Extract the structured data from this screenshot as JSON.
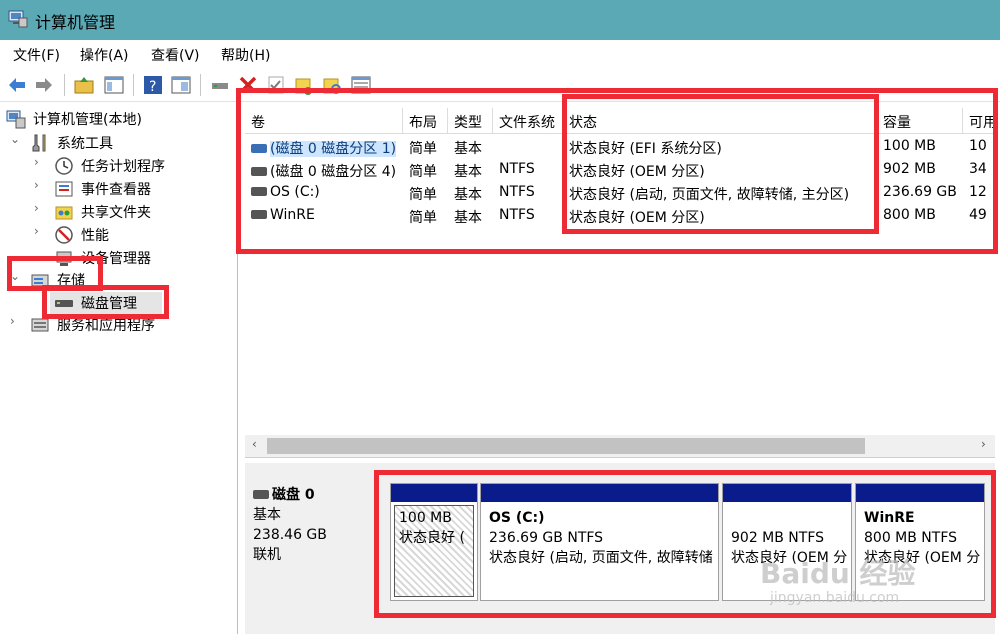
{
  "window": {
    "title": "计算机管理"
  },
  "menu": [
    "文件(F)",
    "操作(A)",
    "查看(V)",
    "帮助(H)"
  ],
  "tree": {
    "root": "计算机管理(本地)",
    "system_tools": "系统工具",
    "task_scheduler": "任务计划程序",
    "event_viewer": "事件查看器",
    "shared_folders": "共享文件夹",
    "performance": "性能",
    "device_manager": "设备管理器",
    "storage": "存储",
    "disk_management": "磁盘管理",
    "services_apps": "服务和应用程序"
  },
  "table": {
    "headers": [
      "卷",
      "布局",
      "类型",
      "文件系统",
      "状态",
      "容量",
      "可用"
    ],
    "rows": [
      [
        "(磁盘 0 磁盘分区 1)",
        "简单",
        "基本",
        "",
        "状态良好 (EFI 系统分区)",
        "100 MB",
        "10"
      ],
      [
        "(磁盘 0 磁盘分区 4)",
        "简单",
        "基本",
        "NTFS",
        "状态良好 (OEM 分区)",
        "902 MB",
        "34"
      ],
      [
        "OS (C:)",
        "简单",
        "基本",
        "NTFS",
        "状态良好 (启动, 页面文件, 故障转储, 主分区)",
        "236.69 GB",
        "12"
      ],
      [
        "WinRE",
        "简单",
        "基本",
        "NTFS",
        "状态良好 (OEM 分区)",
        "800 MB",
        "49"
      ]
    ],
    "hscroll_left": "‹",
    "hscroll_right": "›"
  },
  "disk": {
    "name": "磁盘 0",
    "type": "基本",
    "size": "238.46 GB",
    "status": "联机"
  },
  "partitions": [
    {
      "name": "",
      "line1": "100 MB",
      "line2": "状态良好 ("
    },
    {
      "name": "OS  (C:)",
      "line1": "236.69 GB NTFS",
      "line2": "状态良好 (启动, 页面文件, 故障转储"
    },
    {
      "name": "",
      "line1": "902 MB NTFS",
      "line2": "状态良好 (OEM 分"
    },
    {
      "name": "WinRE",
      "line1": "800 MB NTFS",
      "line2": "状态良好 (OEM 分"
    }
  ],
  "watermark": {
    "brand": "Baidu 经验",
    "url": "jingyan.baidu.com"
  },
  "colors": {
    "titlebar": "#5aa9b5",
    "highlight": "#ee2b35",
    "partition_bar": "#0a1c8c"
  }
}
